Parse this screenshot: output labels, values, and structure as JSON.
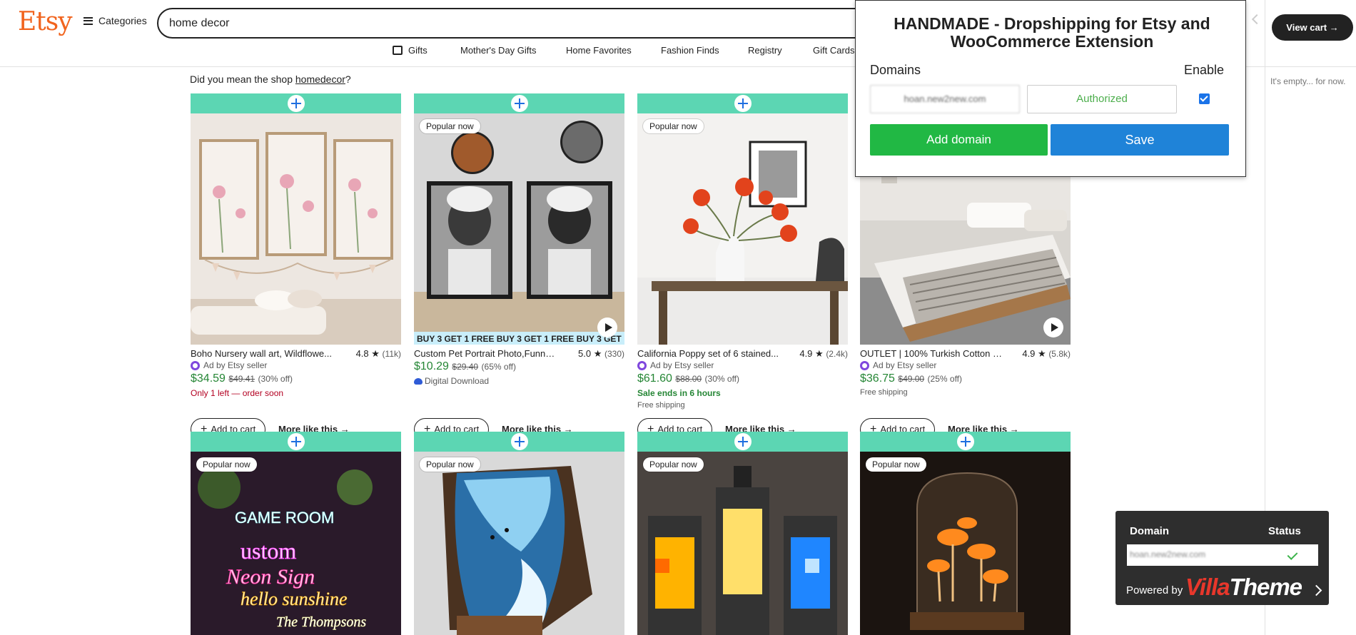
{
  "header": {
    "logo": "Etsy",
    "categories_label": "Categories",
    "search_value": "home decor",
    "view_cart_label": "View cart →"
  },
  "nav": {
    "items": [
      "Gifts",
      "Mother's Day Gifts",
      "Home Favorites",
      "Fashion Finds",
      "Registry",
      "Gift Cards"
    ]
  },
  "suggestion": {
    "prefix": "Did you mean the shop ",
    "shop": "homedecor",
    "suffix": "?"
  },
  "sidebar": {
    "empty_text": "It's empty... for now."
  },
  "products": [
    {
      "title": "Boho Nursery wall art, Wildflowe...",
      "rating": "4.8 ★",
      "reviews": "(11k)",
      "ad": "Ad by Etsy seller",
      "price": "$34.59",
      "original_price": "$49.41",
      "discount": "(30% off)",
      "extra": "Only 1 left — order soon",
      "extra2": "",
      "add_to_cart": "Add to cart",
      "more_like_this": "More like this"
    },
    {
      "title": "Custom Pet Portrait Photo,Funny...",
      "rating": "5.0 ★",
      "reviews": "(330)",
      "badge": "Popular now",
      "ad": "",
      "price": "$10.29",
      "original_price": "$29.40",
      "discount": "(65% off)",
      "extra": "Digital Download",
      "extra2": "",
      "image_strip_text": "BUY 3 GET 1 FREE   BUY 3 GET 1 FREE   BUY 3 GET",
      "add_to_cart": "Add to cart",
      "more_like_this": "More like this"
    },
    {
      "title": "California Poppy set of 6 stained...",
      "rating": "4.9 ★",
      "reviews": "(2.4k)",
      "badge": "Popular now",
      "ad": "Ad by Etsy seller",
      "price": "$61.60",
      "original_price": "$88.00",
      "discount": "(30% off)",
      "extra": "Sale ends in 6 hours",
      "extra2": "Free shipping",
      "add_to_cart": "Add to cart",
      "more_like_this": "More like this"
    },
    {
      "title": "OUTLET | 100% Turkish Cotton F...",
      "rating": "4.9 ★",
      "reviews": "(5.8k)",
      "ad": "Ad by Etsy seller",
      "price": "$36.75",
      "original_price": "$49.00",
      "discount": "(25% off)",
      "extra": "Free shipping",
      "extra2": "",
      "add_to_cart": "Add to cart",
      "more_like_this": "More like this"
    }
  ],
  "row2_badges": [
    "Popular now",
    "Popular now",
    "Popular now",
    "Popular now"
  ],
  "neon_sign": {
    "line1": "GAME ROOM",
    "line2": "ustom",
    "line3": "Neon Sign",
    "line4": "hello sunshine",
    "line5": "The Thompsons"
  },
  "popup": {
    "title": "HANDMADE - Dropshipping for Etsy and WooCommerce Extension",
    "domains_label": "Domains",
    "enable_label": "Enable",
    "domain_value": "hoan.new2new.com",
    "status_value": "Authorized",
    "add_domain_label": "Add domain",
    "save_label": "Save"
  },
  "villatheme": {
    "domain_header": "Domain",
    "status_header": "Status",
    "domain_value": "hoan.new2new.com",
    "powered_by": "Powered by",
    "brand_villa": "Villa",
    "brand_theme": "Theme"
  },
  "colors": {
    "etsy_orange": "#f1641e",
    "teal_bar": "#5cd6b3",
    "price_green": "#258635",
    "add_domain_green": "#21b844",
    "save_blue": "#1f83d8",
    "villatheme_red": "#e8372b"
  }
}
